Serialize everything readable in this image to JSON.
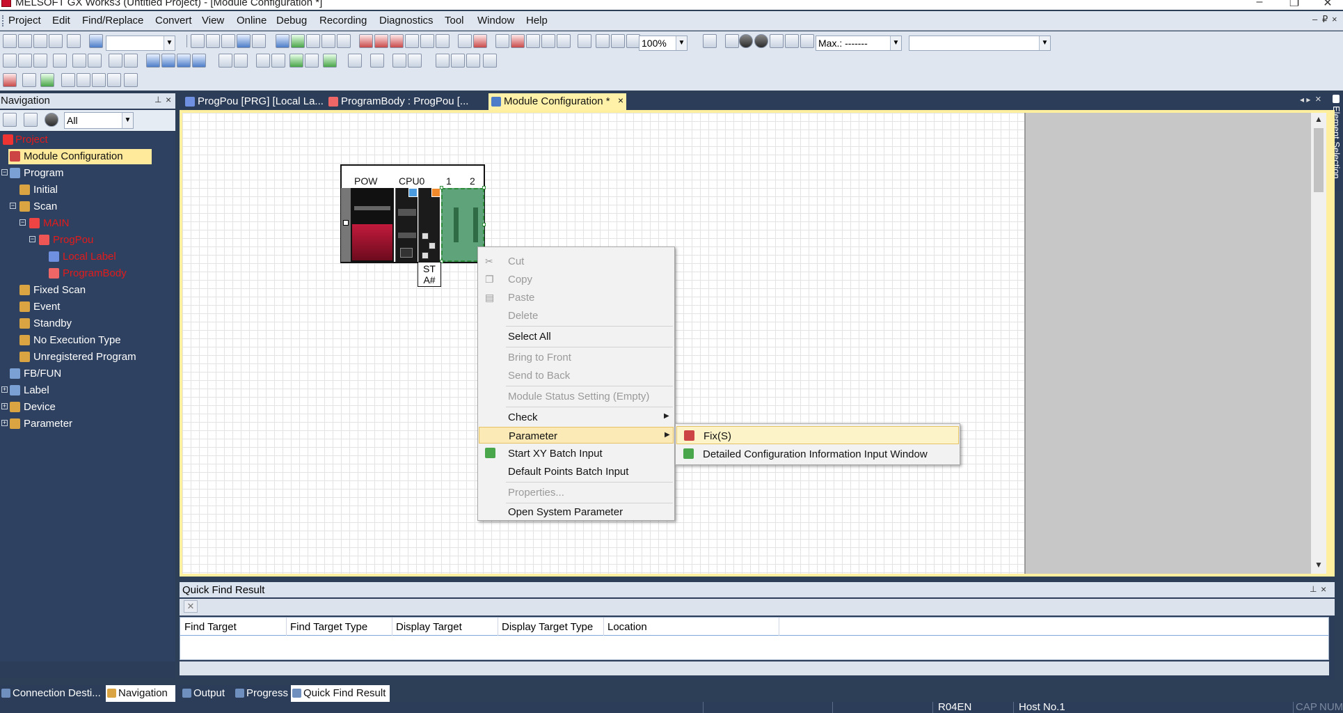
{
  "window": {
    "title": "MELSOFT GX Works3 (Untitled Project) - [Module Configuration *]",
    "controls": [
      "–",
      "❐",
      "✕"
    ]
  },
  "menubar": {
    "items": [
      "Project",
      "Edit",
      "Find/Replace",
      "Convert",
      "View",
      "Online",
      "Debug",
      "Recording",
      "Diagnostics",
      "Tool",
      "Window",
      "Help"
    ],
    "mdi_controls": [
      "–",
      "₽",
      "×"
    ]
  },
  "toolbar": {
    "zoom_value": "100%",
    "max_label": "Max.: -------"
  },
  "navigation": {
    "title": "Navigation",
    "filter_value": "All",
    "tree": [
      {
        "label": "Project",
        "red": true
      },
      {
        "label": "Module Configuration",
        "selected": true
      },
      {
        "label": "Program"
      },
      {
        "label": "Initial"
      },
      {
        "label": "Scan"
      },
      {
        "label": "MAIN",
        "red": true
      },
      {
        "label": "ProgPou",
        "red": true
      },
      {
        "label": "Local Label",
        "red": true
      },
      {
        "label": "ProgramBody",
        "red": true
      },
      {
        "label": "Fixed Scan"
      },
      {
        "label": "Event"
      },
      {
        "label": "Standby"
      },
      {
        "label": "No Execution Type"
      },
      {
        "label": "Unregistered Program"
      },
      {
        "label": "FB/FUN"
      },
      {
        "label": "Label"
      },
      {
        "label": "Device"
      },
      {
        "label": "Parameter"
      }
    ]
  },
  "bottom_tabs": [
    "Connection Desti...",
    "Navigation",
    "Output",
    "Progress",
    "Quick Find Result"
  ],
  "doc_tabs": [
    {
      "label": "ProgPou [PRG] [Local La..."
    },
    {
      "label": "ProgramBody : ProgPou [..."
    },
    {
      "label": "Module Configuration *",
      "active": true
    }
  ],
  "element_selection": "Element Selection",
  "module_config": {
    "slots": [
      "POW",
      "CPU0",
      "1",
      "2"
    ],
    "sta_label": "ST A#"
  },
  "context_menu": {
    "items": [
      {
        "label": "Cut",
        "disabled": true,
        "icon": "scissors-icon"
      },
      {
        "label": "Copy",
        "disabled": true,
        "icon": "copy-icon"
      },
      {
        "label": "Paste",
        "disabled": true,
        "icon": "paste-icon"
      },
      {
        "label": "Delete",
        "disabled": true
      },
      {
        "label": "Select All"
      },
      {
        "label": "Bring to Front",
        "disabled": true
      },
      {
        "label": "Send to Back",
        "disabled": true
      },
      {
        "label": "Module Status Setting (Empty)",
        "disabled": true
      },
      {
        "label": "Check",
        "submenu": true
      },
      {
        "label": "Parameter",
        "submenu": true,
        "highlighted": true
      },
      {
        "label": "Start XY Batch Input",
        "icon": "xy-batch-icon"
      },
      {
        "label": "Default Points Batch Input"
      },
      {
        "label": "Properties...",
        "disabled": true
      },
      {
        "label": "Open System Parameter"
      }
    ],
    "submenu_parameter": [
      {
        "label": "Fix(S)",
        "highlighted": true
      },
      {
        "label": "Detailed Configuration Information Input Window"
      }
    ]
  },
  "quick_find": {
    "title": "Quick Find Result",
    "columns": [
      "Find Target",
      "Find Target Type",
      "Display Target",
      "Display Target Type",
      "Location"
    ]
  },
  "statusbar": {
    "cpu": "R04EN",
    "host": "Host No.1",
    "cap": "CAP",
    "num": "NUM"
  }
}
